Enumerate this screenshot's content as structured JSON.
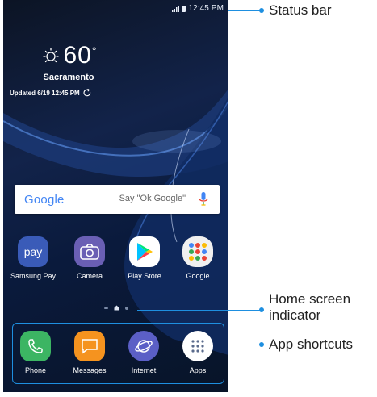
{
  "status_bar": {
    "time": "12:45 PM"
  },
  "weather": {
    "temperature": "60",
    "city": "Sacramento",
    "updated": "Updated 6/19 12:45 PM"
  },
  "search": {
    "logo": "Google",
    "placeholder": "Say \"Ok Google\""
  },
  "home_apps": [
    {
      "label": "Samsung Pay",
      "icon": "samsung-pay-icon",
      "color": "#3a5bb8"
    },
    {
      "label": "Camera",
      "icon": "camera-icon",
      "color": "#6a5fb4"
    },
    {
      "label": "Play Store",
      "icon": "play-store-icon",
      "color": "#ffffff"
    },
    {
      "label": "Google",
      "icon": "google-folder-icon",
      "color": "#f0f0f0"
    }
  ],
  "dock_apps": [
    {
      "label": "Phone",
      "icon": "phone-icon",
      "color": "#3cb563"
    },
    {
      "label": "Messages",
      "icon": "messages-icon",
      "color": "#f5931f"
    },
    {
      "label": "Internet",
      "icon": "internet-icon",
      "color": "#5b5fc6"
    },
    {
      "label": "Apps",
      "icon": "apps-icon",
      "color": "#ffffff"
    }
  ],
  "callouts": {
    "status_bar": "Status bar",
    "home_indicator_line1": "Home screen",
    "home_indicator_line2": "indicator",
    "app_shortcuts": "App shortcuts"
  },
  "accent_color": "#1e8fe0"
}
